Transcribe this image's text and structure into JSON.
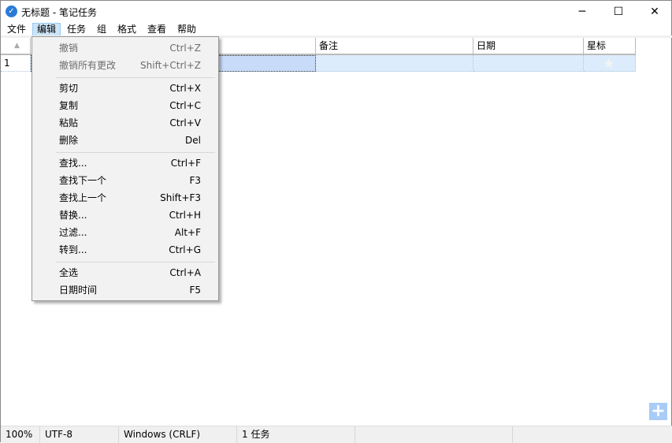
{
  "window": {
    "title": "无标题 - 笔记任务",
    "min": "─",
    "max": "☐",
    "close": "✕"
  },
  "menubar": [
    "文件",
    "编辑",
    "任务",
    "组",
    "格式",
    "查看",
    "帮助"
  ],
  "grid": {
    "headers": [
      "备注",
      "日期",
      "星标"
    ],
    "row_number": "1"
  },
  "edit_menu": [
    {
      "label": "撤销",
      "shortcut": "Ctrl+Z",
      "disabled": true
    },
    {
      "label": "撤销所有更改",
      "shortcut": "Shift+Ctrl+Z",
      "disabled": true
    },
    {
      "label": "剪切",
      "shortcut": "Ctrl+X"
    },
    {
      "label": "复制",
      "shortcut": "Ctrl+C"
    },
    {
      "label": "粘贴",
      "shortcut": "Ctrl+V"
    },
    {
      "label": "删除",
      "shortcut": "Del"
    },
    {
      "label": "查找...",
      "shortcut": "Ctrl+F"
    },
    {
      "label": "查找下一个",
      "shortcut": "F3"
    },
    {
      "label": "查找上一个",
      "shortcut": "Shift+F3"
    },
    {
      "label": "替换...",
      "shortcut": "Ctrl+H"
    },
    {
      "label": "过滤...",
      "shortcut": "Alt+F"
    },
    {
      "label": "转到...",
      "shortcut": "Ctrl+G"
    },
    {
      "label": "全选",
      "shortcut": "Ctrl+A"
    },
    {
      "label": "日期时间",
      "shortcut": "F5"
    }
  ],
  "status": {
    "zoom": "100%",
    "encoding": "UTF-8",
    "line_ending": "Windows (CRLF)",
    "count": "1 任务"
  }
}
